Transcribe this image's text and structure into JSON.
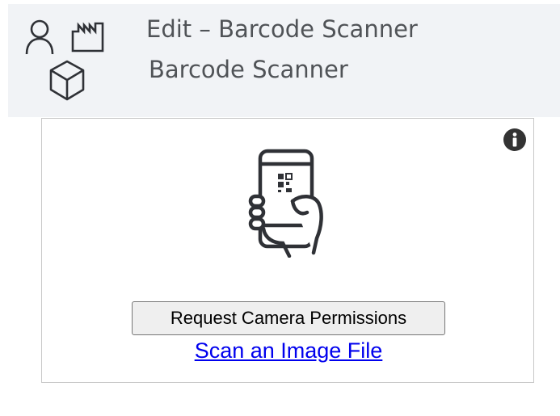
{
  "header": {
    "title": "Edit – Barcode Scanner",
    "subtitle": "Barcode Scanner",
    "icons": [
      "user-icon",
      "factory-icon",
      "cube-icon"
    ]
  },
  "scanner": {
    "info_icon": "info-icon",
    "illustration": "phone-qr-scan-icon",
    "request_button_label": "Request Camera Permissions",
    "scan_file_link_label": "Scan an Image File"
  },
  "colors": {
    "header_bg": "#f1f3f6",
    "header_text": "#505357",
    "icon_stroke": "#2f3136",
    "link": "#0000ee",
    "button_bg": "#efefef"
  }
}
